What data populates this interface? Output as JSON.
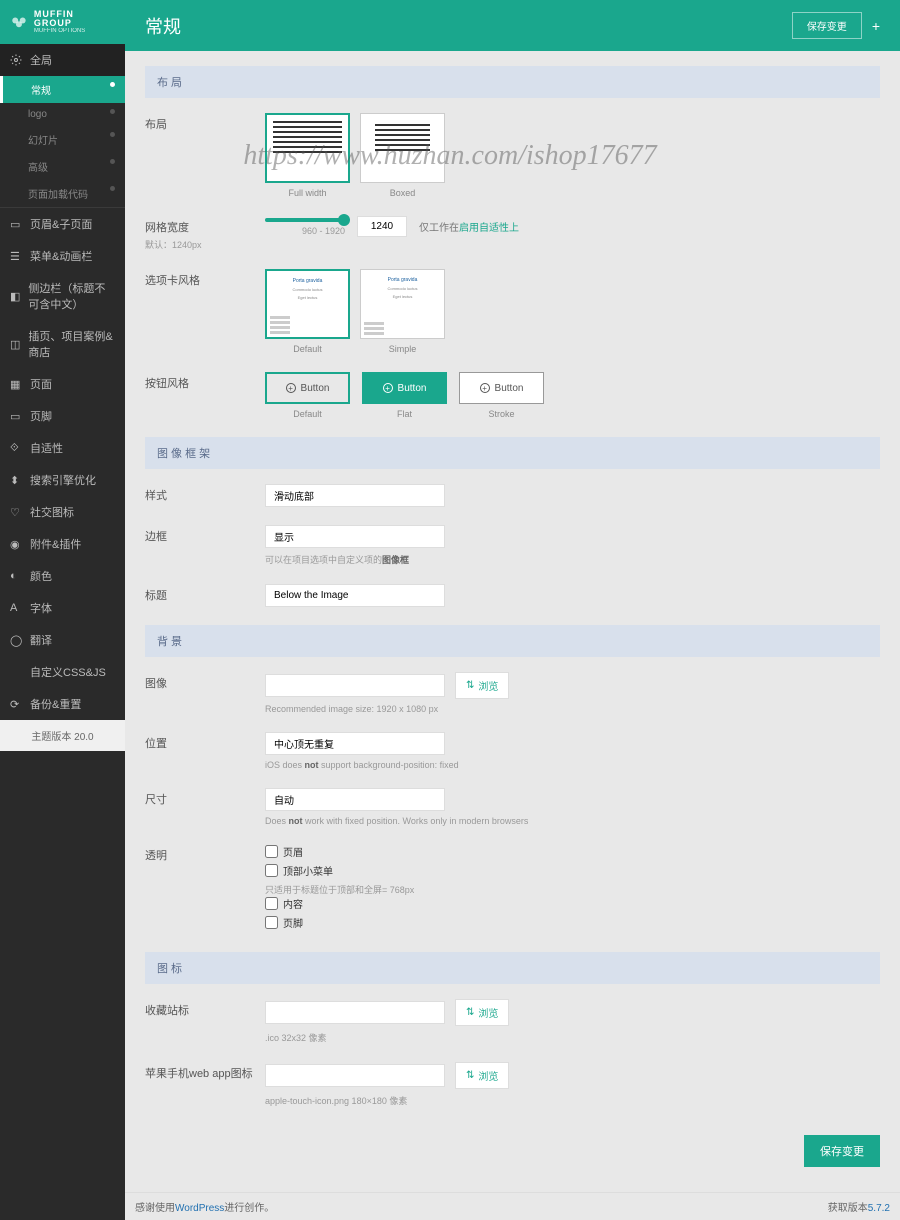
{
  "watermark": "https://www.huzhan.com/ishop17677",
  "brand": {
    "main": "MUFFIN GROUP",
    "sub": "MUFFIN OPTIONS"
  },
  "nav": {
    "global": "全局",
    "global_items": [
      "常规",
      "logo",
      "幻灯片",
      "高级",
      "页面加载代码"
    ],
    "items": [
      "页眉&子页面",
      "菜单&动画栏",
      "侧边栏（标题不可含中文）",
      "插页、项目案例&商店",
      "页面",
      "页脚",
      "自适性",
      "搜索引擎优化",
      "社交图标",
      "附件&插件",
      "颜色",
      "字体",
      "翻译",
      "自定义CSS&JS",
      "备份&重置"
    ]
  },
  "theme_version": "主题版本 20.0",
  "header": {
    "title": "常规",
    "save": "保存变更",
    "collapse": "+"
  },
  "sections": {
    "layout": "布 局",
    "caption": "图 像 框 架",
    "background": "背 景",
    "icons": "图 标"
  },
  "layout": {
    "label": "布局",
    "options": [
      "Full width",
      "Boxed"
    ]
  },
  "grid": {
    "label": "网格宽度",
    "default_label": "默认：1240px",
    "range": "960 - 1920",
    "value": "1240",
    "note_prefix": "仅工作在",
    "note_link": "启用自适性上"
  },
  "tabs": {
    "label": "选项卡风格",
    "title_text": "Porta gravida",
    "sub_text": "Commodo luctus",
    "sub_text2": "Eget lectus",
    "options": [
      "Default",
      "Simple"
    ]
  },
  "buttons": {
    "label": "按钮风格",
    "text": "Button",
    "options": [
      "Default",
      "Flat",
      "Stroke"
    ]
  },
  "style": {
    "label": "样式",
    "value": "滑动底部"
  },
  "border": {
    "label": "边框",
    "value": "显示",
    "help_prefix": "可以在项目选项中自定义项的",
    "help_bold": "图像框"
  },
  "title": {
    "label": "标题",
    "value": "Below the Image"
  },
  "image": {
    "label": "图像",
    "browse": "浏览",
    "help": "Recommended image size: 1920 x 1080 px"
  },
  "position": {
    "label": "位置",
    "value": "中心顶无重复",
    "help_prefix": "iOS does ",
    "help_bold": "not",
    "help_suffix": " support background-position: fixed"
  },
  "size": {
    "label": "尺寸",
    "value": "自动",
    "help_prefix": "Does ",
    "help_bold": "not",
    "help_suffix": " work with fixed position. Works only in modern browsers"
  },
  "transparent": {
    "label": "透明",
    "options": [
      "页眉",
      "顶部小菜单",
      "内容",
      "页脚"
    ],
    "help": "只适用于标题位于顶部和全屏= 768px"
  },
  "favicon": {
    "label": "收藏站标",
    "browse": "浏览",
    "help": ".ico 32x32 像素"
  },
  "apple_icon": {
    "label": "苹果手机web app图标",
    "browse": "浏览",
    "help": "apple-touch-icon.png 180×180 像素"
  },
  "footer_save": "保存变更",
  "page_footer": {
    "left_prefix": "感谢使用",
    "left_link": "WordPress",
    "left_suffix": "进行创作。",
    "right_label": "获取版本",
    "right_ver": "5.7.2"
  }
}
